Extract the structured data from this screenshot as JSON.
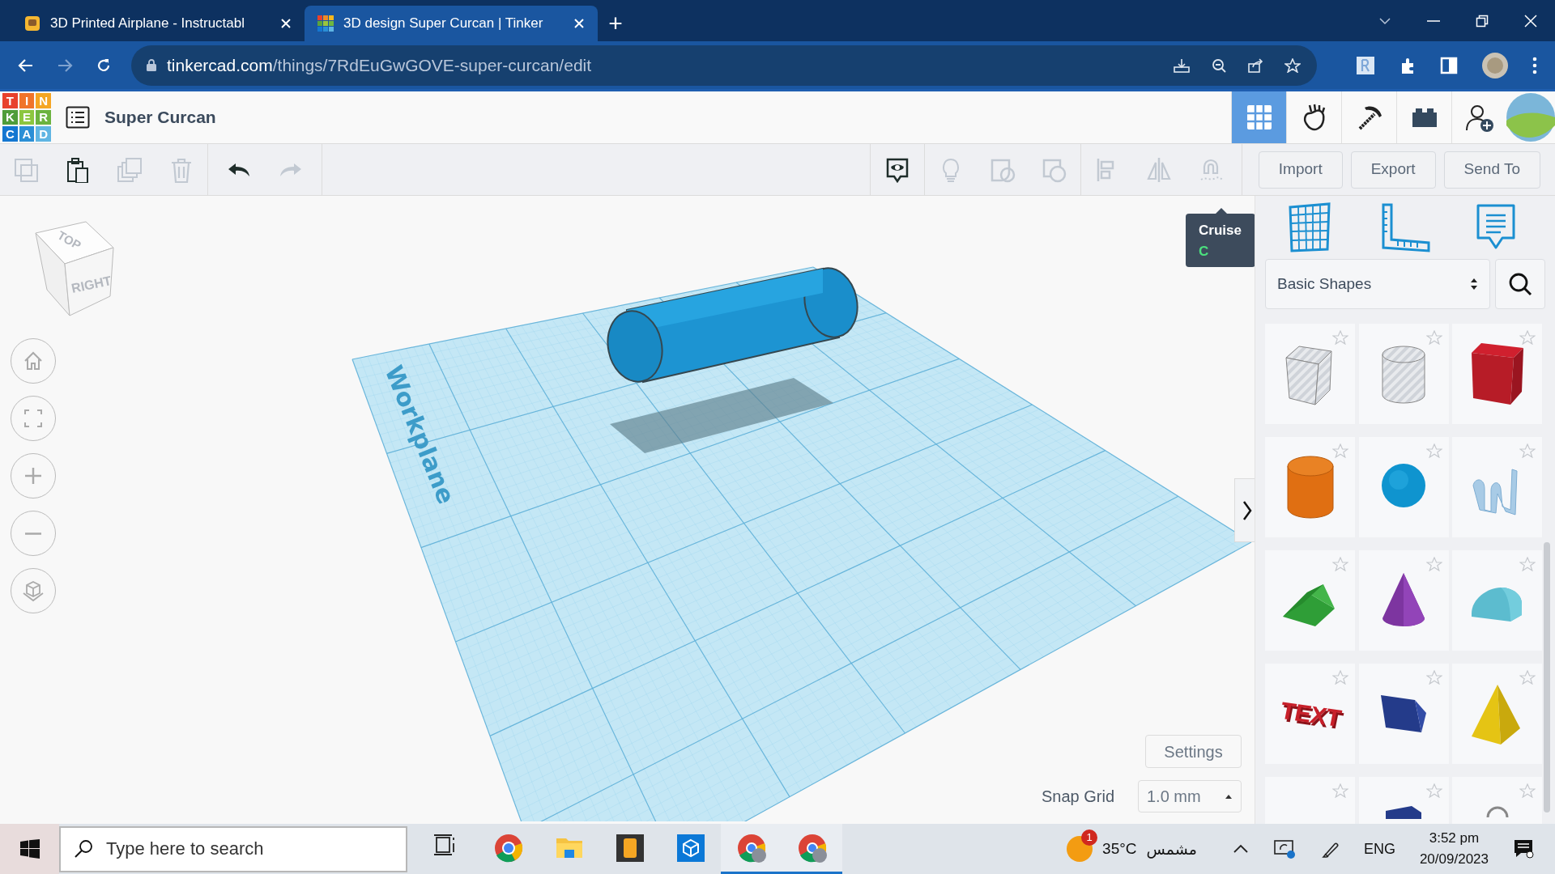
{
  "browser": {
    "tabs": [
      {
        "title": "3D Printed Airplane - Instructabl",
        "selected": false
      },
      {
        "title": "3D design Super Curcan | Tinker",
        "selected": true
      }
    ],
    "new_tab": "+",
    "url_host": "tinkercad.com",
    "url_path": "/things/7RdEuGwGOVE-super-curcan/edit"
  },
  "app": {
    "logo": [
      "T",
      "I",
      "N",
      "K",
      "E",
      "R",
      "C",
      "A",
      "D"
    ],
    "design_title": "Super Curcan",
    "nav_icons": [
      {
        "kind": "grid",
        "selected": true
      },
      {
        "kind": "hand",
        "selected": false
      },
      {
        "kind": "pickaxe",
        "selected": false
      },
      {
        "kind": "brick",
        "selected": false
      },
      {
        "kind": "add-user",
        "selected": false
      }
    ]
  },
  "toolbar": {
    "edit_tools": [
      {
        "kind": "copy",
        "disabled": true
      },
      {
        "kind": "paste",
        "disabled": false
      },
      {
        "kind": "duplicate",
        "disabled": true
      },
      {
        "kind": "delete",
        "disabled": true
      },
      {
        "kind": "undo",
        "disabled": false
      },
      {
        "kind": "redo",
        "disabled": true
      }
    ],
    "view_tools": [
      {
        "kind": "note",
        "disabled": false
      },
      {
        "kind": "bulb",
        "disabled": true
      },
      {
        "kind": "group",
        "disabled": true
      },
      {
        "kind": "ungroup",
        "disabled": true
      },
      {
        "kind": "align",
        "disabled": true
      },
      {
        "kind": "mirror",
        "disabled": true
      },
      {
        "kind": "magnet",
        "disabled": true
      }
    ],
    "buttons": [
      "Import",
      "Export",
      "Send To"
    ]
  },
  "tooltip": {
    "title": "Cruise",
    "shortcut": "C"
  },
  "view_cube": {
    "top": "TOP",
    "right": "RIGHT"
  },
  "view_controls": [
    {
      "kind": "home"
    },
    {
      "kind": "fit"
    },
    {
      "kind": "zoom-in"
    },
    {
      "kind": "zoom-out"
    },
    {
      "kind": "perspective"
    }
  ],
  "workplane": {
    "label": "Workplane"
  },
  "panel": {
    "tools": [
      {
        "kind": "grid"
      },
      {
        "kind": "ruler"
      },
      {
        "kind": "notes"
      }
    ],
    "category": "Basic Shapes",
    "shapes": [
      {
        "kind": "box-hole"
      },
      {
        "kind": "cylinder-hole"
      },
      {
        "kind": "box"
      },
      {
        "kind": "cylinder"
      },
      {
        "kind": "sphere"
      },
      {
        "kind": "scribble"
      },
      {
        "kind": "roof"
      },
      {
        "kind": "cone"
      },
      {
        "kind": "round-roof"
      },
      {
        "kind": "text",
        "text": "TEXT"
      },
      {
        "kind": "prism"
      },
      {
        "kind": "pyramid"
      },
      {
        "kind": "partial-empty"
      },
      {
        "kind": "partial-prism"
      },
      {
        "kind": "partial-ring"
      }
    ]
  },
  "settings_button": "Settings",
  "snap_grid": {
    "label": "Snap Grid",
    "value": "1.0 mm"
  },
  "taskbar": {
    "search_placeholder": "Type here to search",
    "apps": [
      {
        "kind": "task-view",
        "active": false
      },
      {
        "kind": "chrome",
        "active": false
      },
      {
        "kind": "folder",
        "active": false
      },
      {
        "kind": "tile-app",
        "active": false
      },
      {
        "kind": "cube-app",
        "active": false
      },
      {
        "kind": "chrome-profile",
        "active": true
      },
      {
        "kind": "chrome-profile",
        "active": true
      }
    ],
    "weather_badge": "1",
    "temperature": "35°C",
    "condition": "مشمس",
    "language": "ENG",
    "time": "3:52 pm",
    "date": "20/09/2023"
  }
}
